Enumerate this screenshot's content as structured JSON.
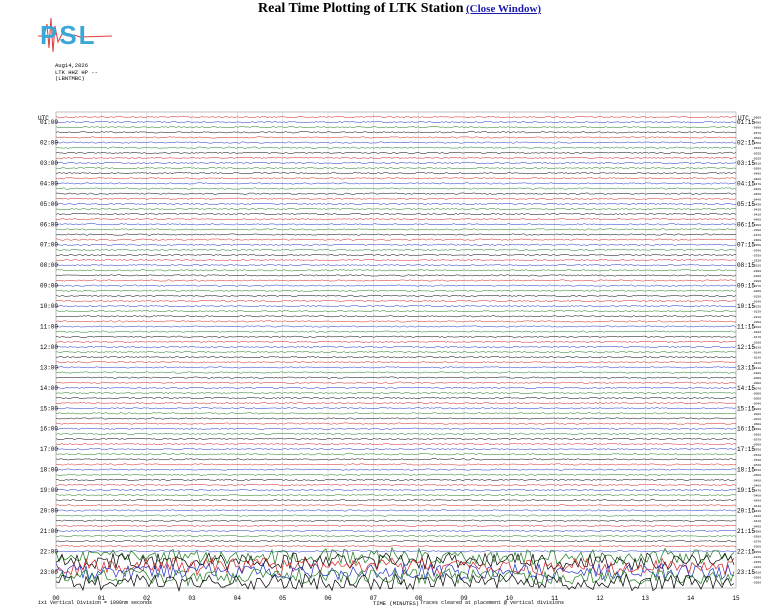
{
  "header": {
    "title": "Real Time Plotting of LTK Station",
    "close_link": "(Close Window)"
  },
  "logo": {
    "text": "PSL",
    "colors": [
      "#39a7d8",
      "#e03a3a"
    ]
  },
  "meta": {
    "date": "Aug14,2026",
    "station": "LTK HHZ HP --",
    "network": "(LBNTMBC)"
  },
  "plot": {
    "utc_label_left": "UTC",
    "utc_label_right": "UTC",
    "trace_colors": [
      "#d42020",
      "#2030c8",
      "#1a7a1a",
      "#000000"
    ],
    "hour_labels_left": [
      "01:00",
      "02:00",
      "03:00",
      "04:00",
      "05:00",
      "06:00",
      "07:00",
      "08:00",
      "09:00",
      "10:00",
      "11:00",
      "12:00",
      "13:00",
      "14:00",
      "15:00",
      "16:00",
      "17:00",
      "18:00",
      "19:00",
      "20:00",
      "21:00",
      "22:00",
      "23:00"
    ],
    "hour_labels_right": [
      "01:15",
      "02:15",
      "03:15",
      "04:15",
      "05:15",
      "06:15",
      "07:15",
      "08:15",
      "09:15",
      "10:15",
      "11:15",
      "12:15",
      "13:15",
      "14:15",
      "15:15",
      "16:15",
      "17:15",
      "18:15",
      "19:15",
      "20:15",
      "21:15",
      "22:15",
      "23:15"
    ],
    "time_ticks": [
      "00",
      "01",
      "02",
      "03",
      "04",
      "05",
      "06",
      "07",
      "08",
      "09",
      "10",
      "11",
      "12",
      "13",
      "14",
      "15"
    ],
    "time_axis_label": "TIME (MINUTES)",
    "traces_per_hour": 4,
    "quiet_amplitude": 0.12,
    "active_amplitude": 1.0,
    "active_start_hour_index": 21
  },
  "footer": {
    "left_note": "1x1 Vertical Division = 1000nm seconds",
    "right_note": "Traces cleared at placement @ vertical divisions"
  }
}
